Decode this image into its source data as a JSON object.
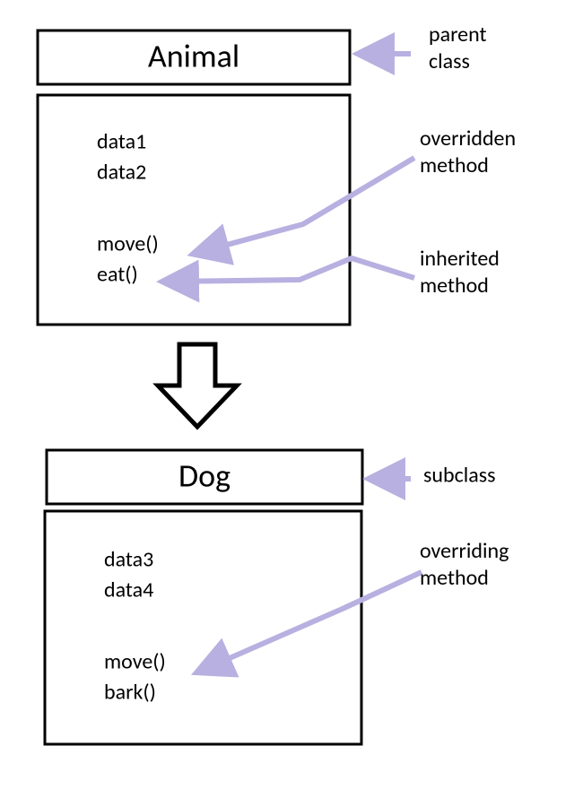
{
  "parent": {
    "title": "Animal",
    "data": [
      "data1",
      "data2"
    ],
    "methods": [
      "move()",
      "eat()"
    ]
  },
  "child": {
    "title": "Dog",
    "data": [
      "data3",
      "data4"
    ],
    "methods": [
      "move()",
      "bark()"
    ]
  },
  "annotations": {
    "parent_class": "parent\nclass",
    "overridden": "overridden\nmethod",
    "inherited": "inherited\nmethod",
    "subclass": "subclass",
    "overriding": "overriding\nmethod"
  }
}
